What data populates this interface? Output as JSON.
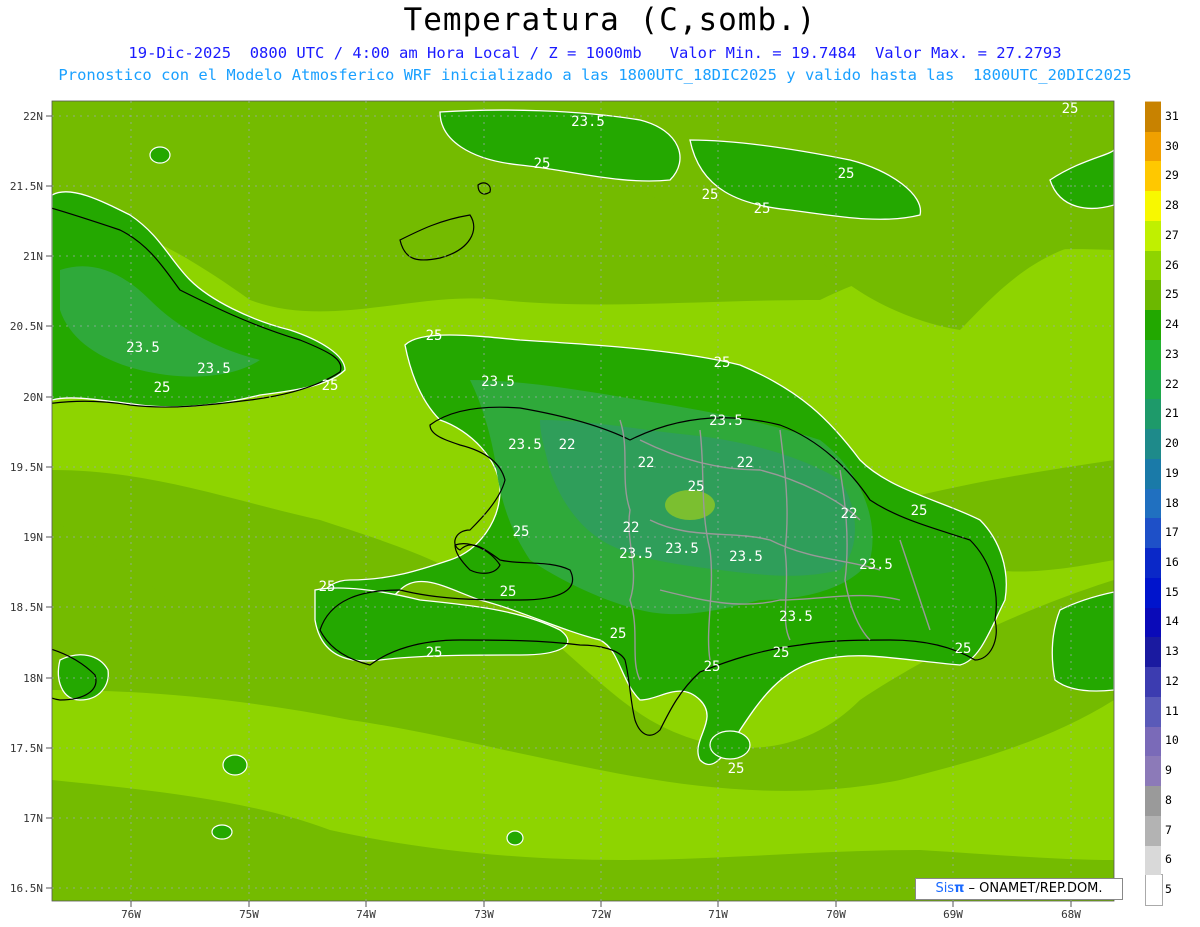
{
  "header": {
    "title": "Temperatura (C,somb.)",
    "line1": "19-Dic-2025  0800 UTC / 4:00 am Hora Local / Z = 1000mb   Valor Min. = 19.7484  Valor Max. = 27.2793",
    "line2": "Pronostico con el Modelo Atmosferico WRF inicializado a las 1800UTC_18DIC2025 y valido hasta las  1800UTC_20DIC2025"
  },
  "map": {
    "lat_labels": [
      "22N",
      "21.5N",
      "21N",
      "20.5N",
      "20N",
      "19.5N",
      "19N",
      "18.5N",
      "18N",
      "17.5N",
      "17N",
      "16.5N"
    ],
    "lon_labels": [
      "76W",
      "75W",
      "74W",
      "73W",
      "72W",
      "71W",
      "70W",
      "69W",
      "68W"
    ],
    "contour_labels": [
      "25",
      "23.5",
      "22"
    ],
    "colors": {
      "sea_light": "#8ed400",
      "sea_mid": "#74bb00",
      "land_24": "#24a800",
      "land_23": "#2fa93a",
      "land_22": "#2f9e5a"
    }
  },
  "colorbar": {
    "levels": [
      "5",
      "6",
      "7",
      "8",
      "9",
      "10",
      "11",
      "12",
      "13",
      "14",
      "15",
      "16",
      "17",
      "18",
      "19",
      "20",
      "21",
      "22",
      "23",
      "24",
      "25",
      "26",
      "27",
      "28",
      "29",
      "30",
      "31"
    ],
    "colors": [
      "#ffffff",
      "#d9d9d9",
      "#b3b3b3",
      "#9a9a9a",
      "#8c7ab8",
      "#7a6ab8",
      "#5a5ab8",
      "#3c3cb0",
      "#1a1aa0",
      "#0a0ab8",
      "#0014cc",
      "#0a28c8",
      "#1e50c8",
      "#2070c0",
      "#1a7aa8",
      "#1e8a8a",
      "#1e9a6a",
      "#1ea84a",
      "#22b030",
      "#22a800",
      "#6cb800",
      "#8fd400",
      "#c0f000",
      "#f8f800",
      "#ffc800",
      "#f0a000",
      "#c88200"
    ]
  },
  "credit": {
    "brand": "Sis",
    "pi": "π",
    "org": "– ONAMET/REP.DOM."
  }
}
